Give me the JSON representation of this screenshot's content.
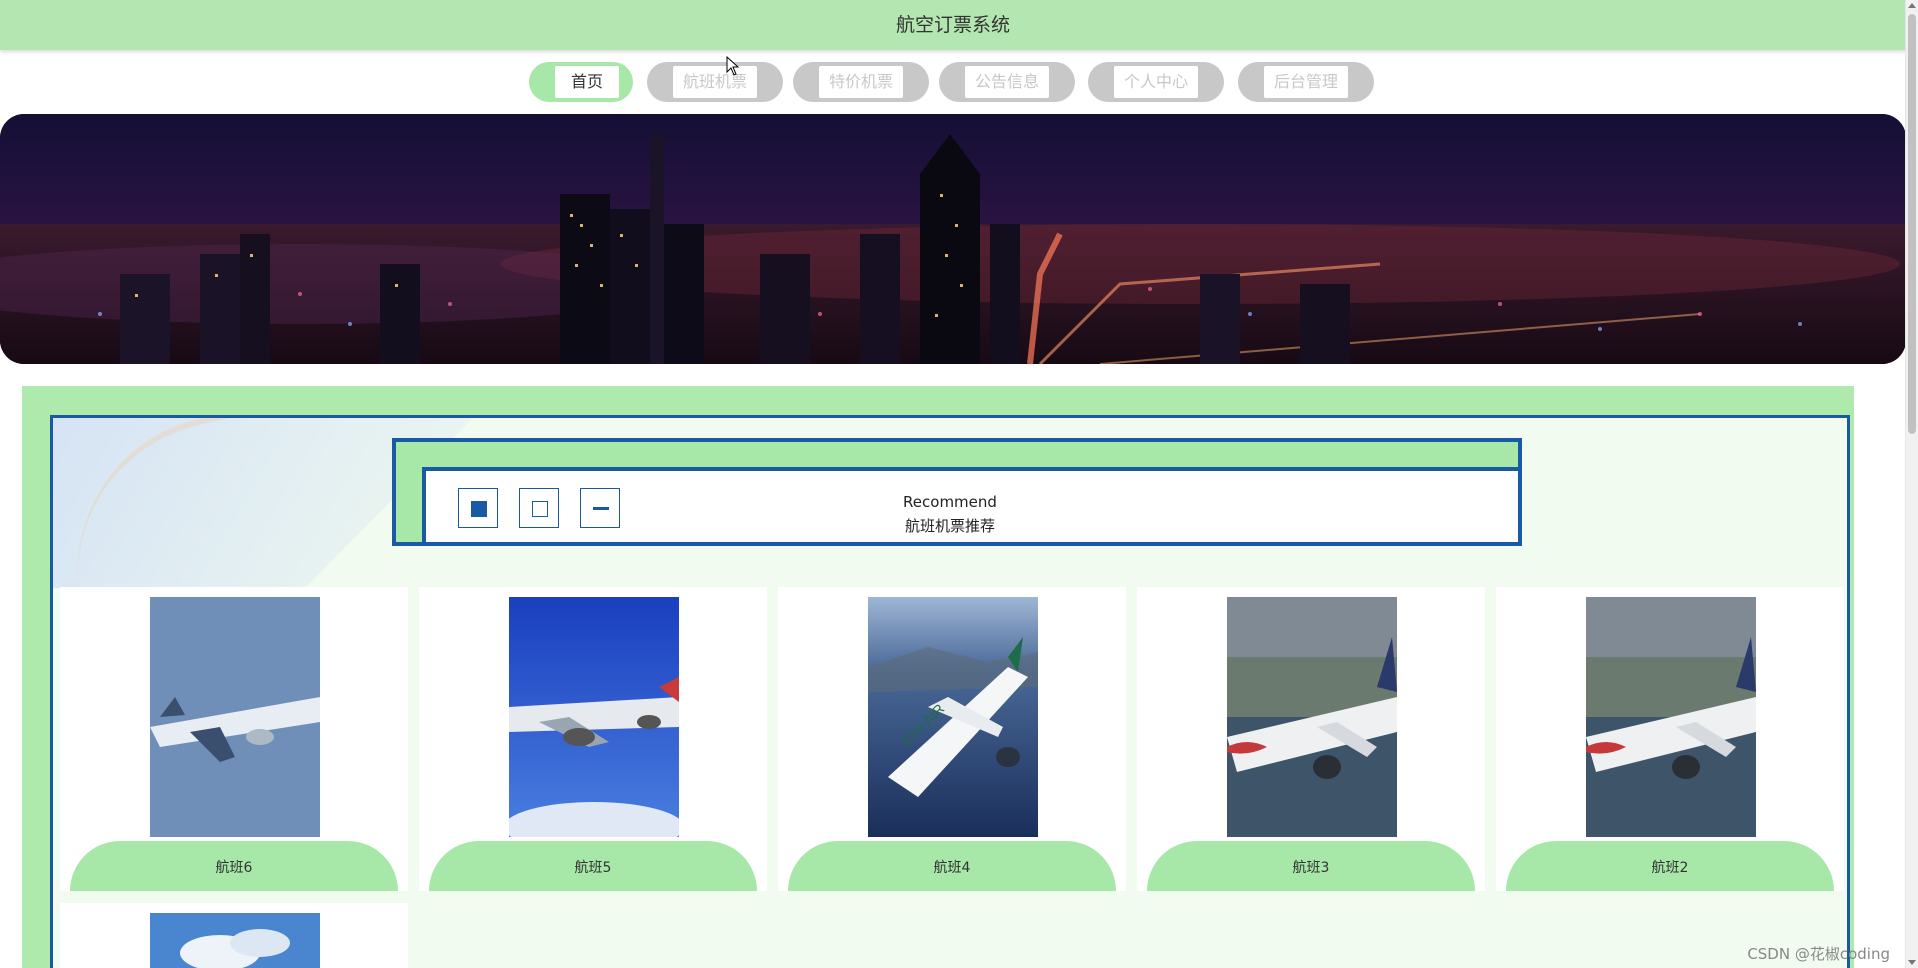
{
  "header": {
    "title": "航空订票系统"
  },
  "nav": {
    "items": [
      {
        "label": "首页",
        "active": true
      },
      {
        "label": "航班机票",
        "active": false
      },
      {
        "label": "特价机票",
        "active": false
      },
      {
        "label": "公告信息",
        "active": false
      },
      {
        "label": "个人中心",
        "active": false
      },
      {
        "label": "后台管理",
        "active": false
      }
    ]
  },
  "section": {
    "title_en": "Recommend",
    "title_cn": "航班机票推荐"
  },
  "cards": [
    {
      "label": "航班6"
    },
    {
      "label": "航班5"
    },
    {
      "label": "航班4"
    },
    {
      "label": "航班3"
    },
    {
      "label": "航班2"
    }
  ],
  "watermark": "CSDN @花椒coding",
  "colors": {
    "header_bg": "#b3e6b1",
    "accent_green": "#a7e8a9",
    "accent_blue": "#1a59a3",
    "nav_inactive": "#c8c8c8"
  }
}
